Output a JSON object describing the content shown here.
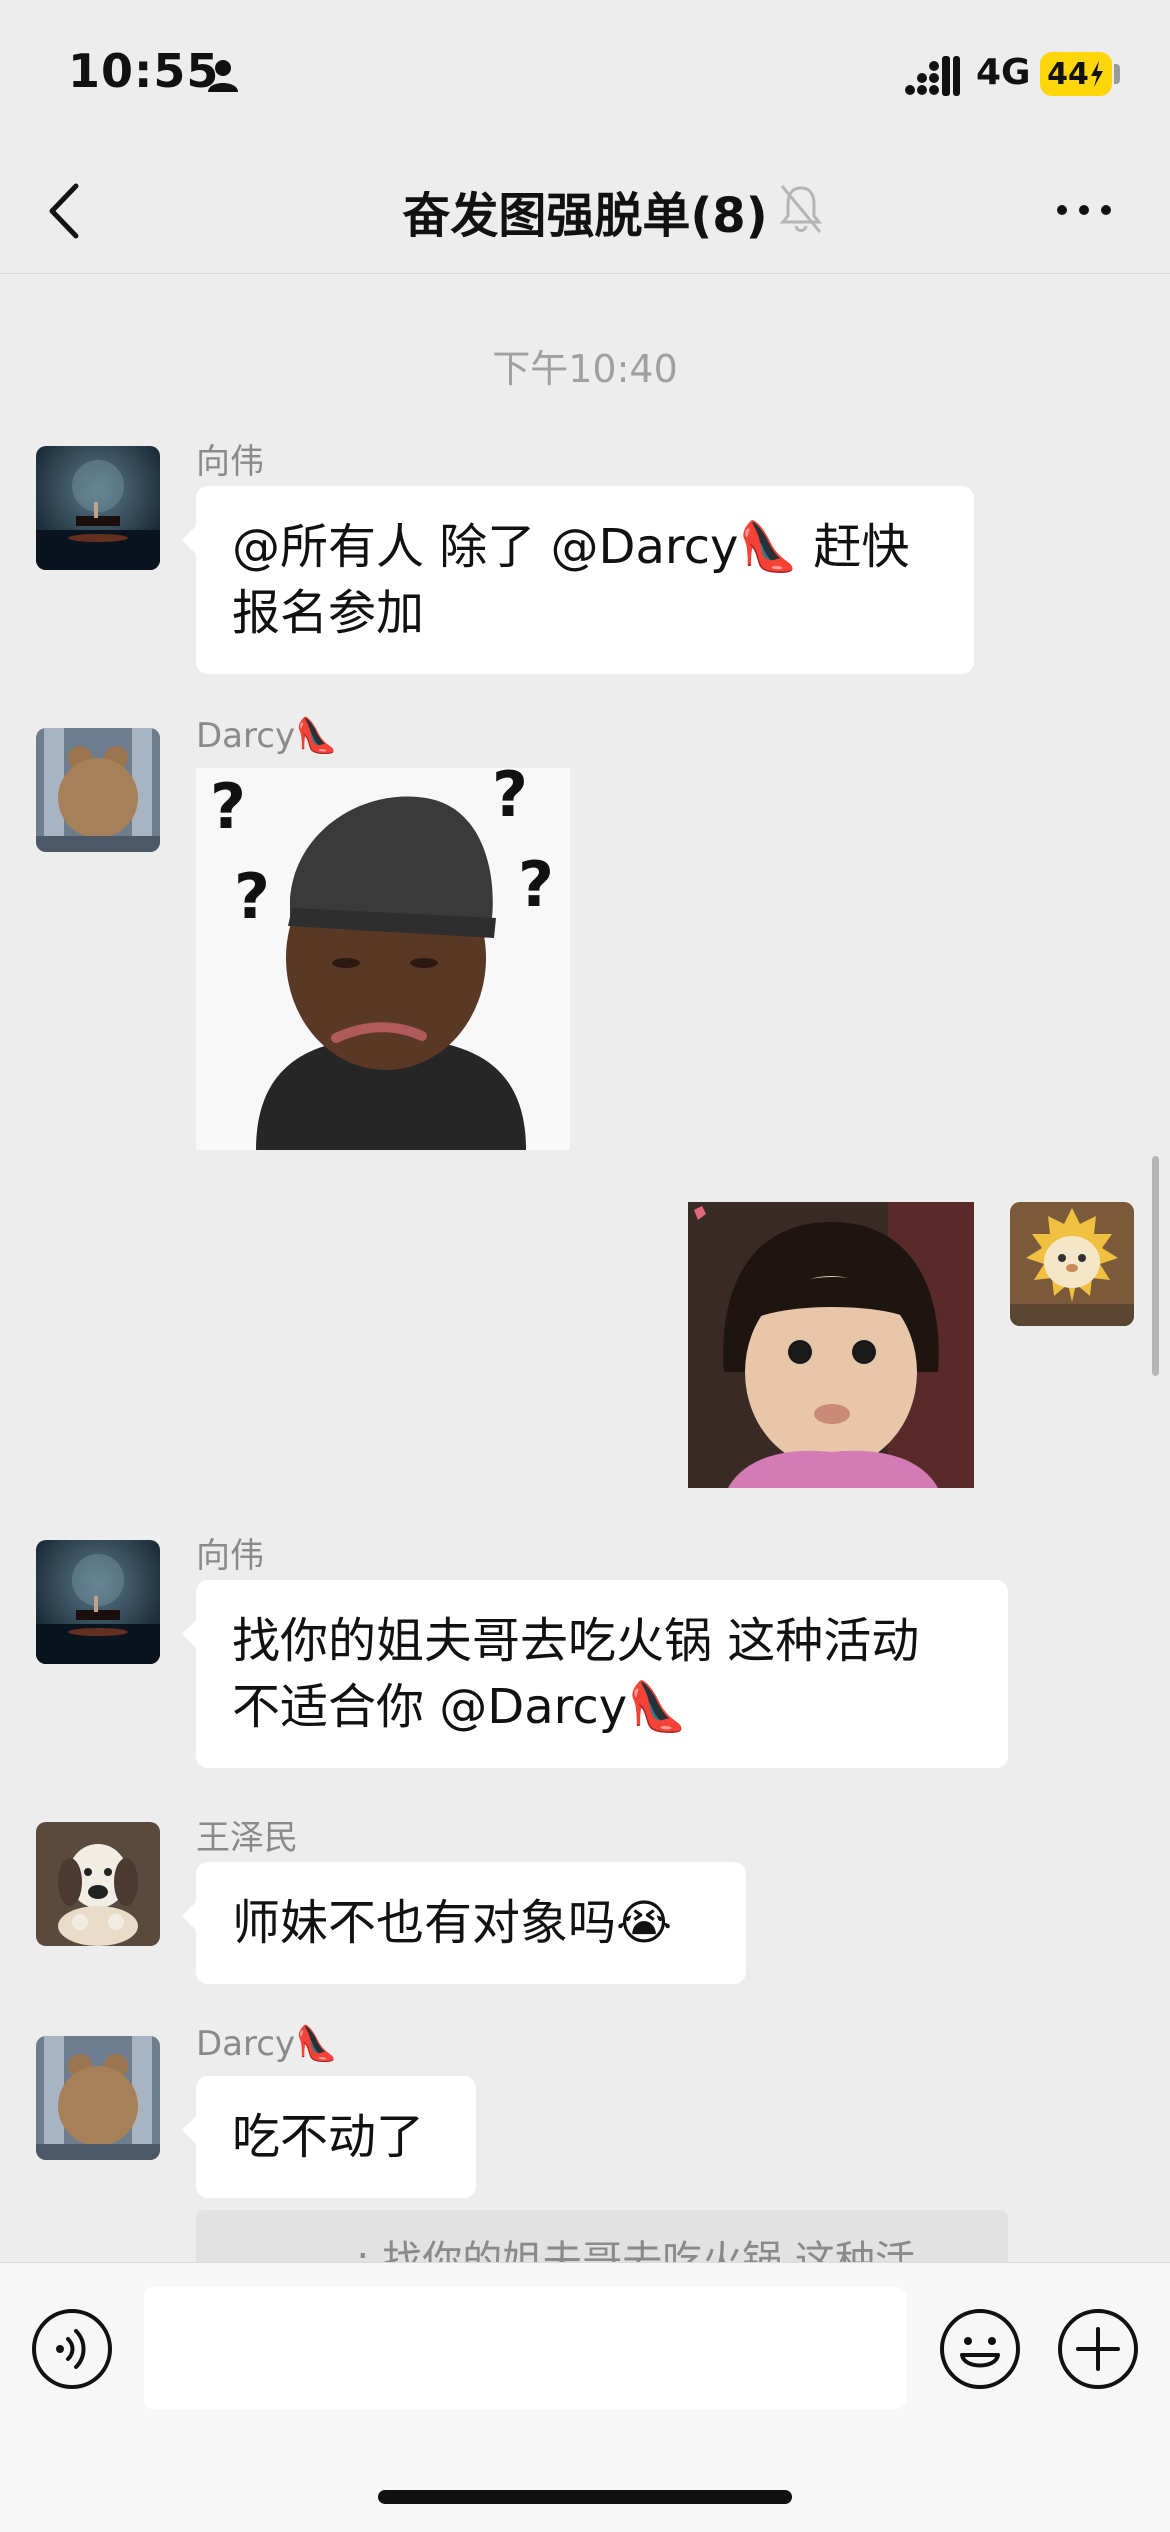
{
  "status_bar": {
    "time": "10:55",
    "network": "4G",
    "battery": "44"
  },
  "nav": {
    "title": "奋发图强脱单(8)"
  },
  "timestamp": "下午10:40",
  "messages": [
    {
      "sender": "向伟",
      "type": "text",
      "lines": [
        "@所有人 除了 @Darcy👠 赶快",
        "报名参加"
      ]
    },
    {
      "sender": "Darcy👠",
      "type": "sticker",
      "sticker": "confused-man-with-question-marks",
      "glyphs": [
        "?",
        "?",
        "?",
        "?"
      ]
    },
    {
      "sender": "me",
      "type": "sticker",
      "sticker": "pouting-little-girl"
    },
    {
      "sender": "向伟",
      "type": "text",
      "lines": [
        "找你的姐夫哥去吃火锅 这种活动",
        "不适合你 @Darcy👠"
      ]
    },
    {
      "sender": "王泽民",
      "type": "text",
      "lines": [
        "师妹不也有对象吗😭"
      ]
    },
    {
      "sender": "Darcy👠",
      "type": "text",
      "lines": [
        "吃不动了"
      ]
    }
  ],
  "quote": {
    "text": ": 找你的姐夫哥去吃火锅 这种活"
  },
  "input": {
    "placeholder": ""
  },
  "colors": {
    "background": "#ededed",
    "bubble": "#ffffff",
    "battery": "#ffd60a",
    "name": "#8a8a8a"
  }
}
